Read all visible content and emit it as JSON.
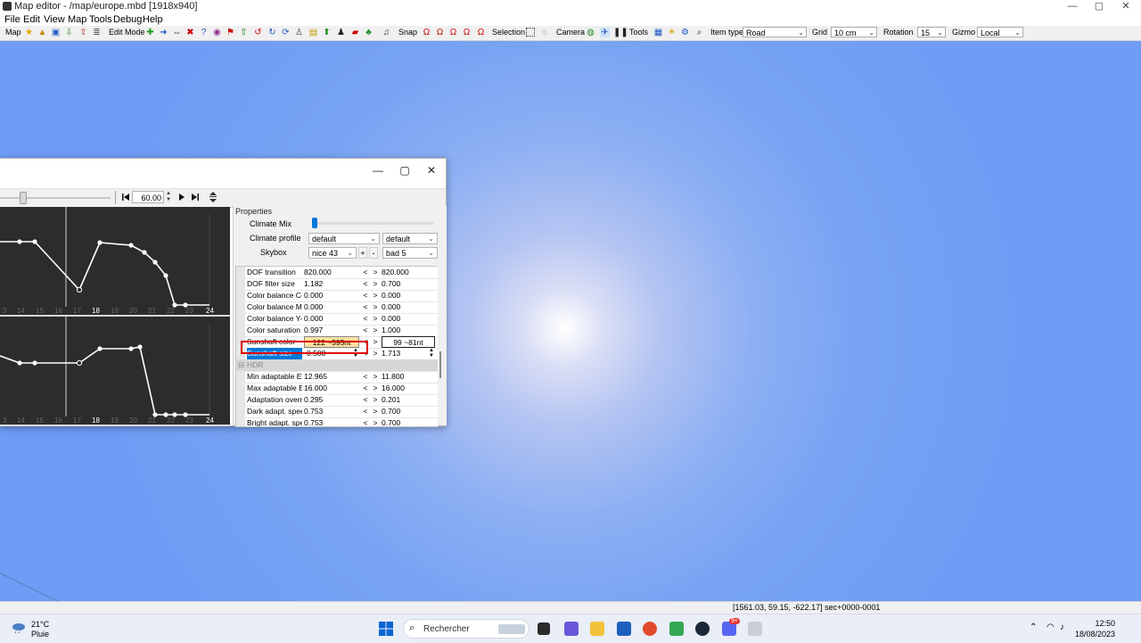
{
  "window": {
    "title": "Map editor - /map/europe.mbd [1918x940]",
    "minimize": "—",
    "maximize": "▢",
    "close": "✕"
  },
  "menu": [
    "File",
    "Edit",
    "View",
    "Map",
    "Tools",
    "Debug",
    "Help"
  ],
  "toolbar": {
    "map": "Map",
    "edit_mode": "Edit Mode",
    "snap": "Snap",
    "selection": "Selection",
    "camera": "Camera",
    "tools": "Tools",
    "item_type_label": "Item type",
    "item_type_value": "Road",
    "grid_label": "Grid",
    "grid_value": "10 cm",
    "rotation_label": "Rotation",
    "rotation_value": "15",
    "gizmo_label": "Gizmo",
    "gizmo_value": "Local"
  },
  "status": {
    "coords": "[1561.03, 59.15, -622.17] sec+0000-0001"
  },
  "taskbar": {
    "temp": "21°C",
    "condition": "Pluie",
    "search_placeholder": "Rechercher",
    "time": "12:50",
    "date": "18/08/2023",
    "badge": "9+"
  },
  "panel": {
    "timeline_value": "60.00",
    "graph_top_labels": [
      "3",
      "14",
      "15",
      "16",
      "17",
      "18",
      "19",
      "20",
      "21",
      "22",
      "23",
      "24"
    ],
    "graph_bottom_labels": [
      "3",
      "14",
      "15",
      "16",
      "17",
      "18",
      "19",
      "20",
      "21",
      "22",
      "23",
      "24"
    ],
    "properties_title": "Properties",
    "climate_mix_label": "Climate Mix",
    "climate_mix_level": 0.0,
    "climate_profile_label": "Climate profile",
    "climate_profile_a": "default",
    "climate_profile_b": "default",
    "skybox_label": "Skybox",
    "skybox_a": "nice 43",
    "skybox_b": "bad 5",
    "plus": "+",
    "minus": "-",
    "rows": [
      {
        "label": "DOF transition",
        "v1": "820.000",
        "v2": "820.000"
      },
      {
        "label": "DOF filter size",
        "v1": "1.182",
        "v2": "0.700"
      },
      {
        "label": "Color balance C-R",
        "v1": "0.000",
        "v2": "0.000"
      },
      {
        "label": "Color balance M-G",
        "v1": "0.000",
        "v2": "0.000"
      },
      {
        "label": "Color balance Y-B",
        "v1": "0.000",
        "v2": "0.000"
      },
      {
        "label": "Color saturation",
        "v1": "0.997",
        "v2": "1.000"
      },
      {
        "label": "Sunshaft color",
        "v1": "122 ~595nt",
        "v2": "99 ~81nt"
      },
      {
        "label": "Sunshaft size",
        "v1": "0.500",
        "v2": "1.713"
      },
      {
        "label": "HDR",
        "v1": "",
        "v2": ""
      },
      {
        "label": "Min adaptable EV",
        "v1": "12.965",
        "v2": "11.800"
      },
      {
        "label": "Max adaptable EV",
        "v1": "16.000",
        "v2": "16.000"
      },
      {
        "label": "Adaptation override",
        "v1": "0.295",
        "v2": "0.201"
      },
      {
        "label": "Dark adapt. speed",
        "v1": "0.753",
        "v2": "0.700"
      },
      {
        "label": "Bright adapt. speed",
        "v1": "0.753",
        "v2": "0.700"
      }
    ],
    "lt": "<",
    "gt": ">"
  }
}
